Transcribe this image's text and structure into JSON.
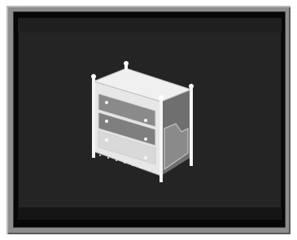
{
  "window": {
    "frame_color": "#8e8e8e",
    "panel_color": "#242424"
  },
  "item": {
    "icon": "dresser-icon",
    "colors": {
      "wood": "#e8e8e8",
      "drawer": "#8a8a8a",
      "shadow": "#6f6f6f"
    }
  }
}
